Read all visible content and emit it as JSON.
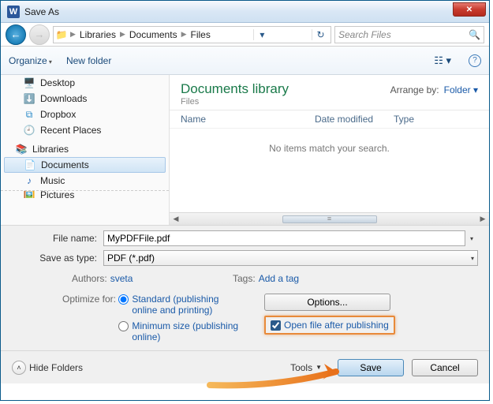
{
  "window": {
    "title": "Save As"
  },
  "breadcrumb": {
    "seg1": "Libraries",
    "seg2": "Documents",
    "seg3": "Files"
  },
  "search": {
    "placeholder": "Search Files"
  },
  "toolbar": {
    "organize": "Organize",
    "newfolder": "New folder"
  },
  "sidebar": {
    "desktop": "Desktop",
    "downloads": "Downloads",
    "dropbox": "Dropbox",
    "recent": "Recent Places",
    "libraries": "Libraries",
    "documents": "Documents",
    "music": "Music",
    "pictures": "Pictures"
  },
  "content": {
    "lib_title": "Documents library",
    "lib_sub": "Files",
    "arrange_label": "Arrange by:",
    "arrange_value": "Folder",
    "col_name": "Name",
    "col_date": "Date modified",
    "col_type": "Type",
    "empty": "No items match your search."
  },
  "form": {
    "filename_label": "File name:",
    "filename_value": "MyPDFFile.pdf",
    "type_label": "Save as type:",
    "type_value": "PDF (*.pdf)",
    "authors_label": "Authors:",
    "authors_value": "sveta",
    "tags_label": "Tags:",
    "tags_value": "Add a tag",
    "optimize_label": "Optimize for:",
    "radio_standard": "Standard (publishing online and printing)",
    "radio_minimum": "Minimum size (publishing online)",
    "options_btn": "Options...",
    "open_after": "Open file after publishing"
  },
  "footer": {
    "hide_folders": "Hide Folders",
    "tools": "Tools",
    "save": "Save",
    "cancel": "Cancel"
  }
}
